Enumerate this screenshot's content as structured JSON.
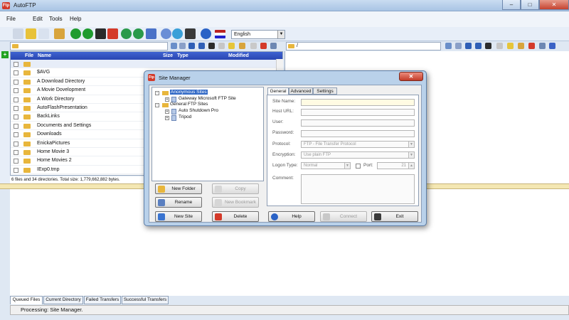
{
  "window": {
    "title": "AutoFTP",
    "app_badge": "Ftp",
    "min": "–",
    "max": "□",
    "close": "✕"
  },
  "menu": {
    "items": [
      "File",
      "Edit",
      "Tools",
      "Help"
    ]
  },
  "toolbar": {
    "language": "English"
  },
  "left_pane": {
    "path": "",
    "columns": [
      "File",
      "Name",
      "Size",
      "Type",
      "Modified"
    ],
    "rows": [
      "",
      "$AVG",
      "A Download Directory",
      "A Movie Dovelopment",
      "A Work Directory",
      "AutoFlashPresentation",
      "BackLinks",
      "Documents and Settings",
      "Downloads",
      "EnickaPictures",
      "Home Movie 3",
      "Home Movies 2",
      "IExp0.tmp"
    ],
    "status": "6 files and 34 directories. Total size: 1,779,662,882 bytes."
  },
  "right_pane": {
    "path": "/"
  },
  "queue_tabs": [
    "Queued Files",
    "Current Directory",
    "Failed Transfers",
    "Successful Transfers"
  ],
  "status_bar": {
    "text": "Processing: Site Manager."
  },
  "site_manager": {
    "title": "Site Manager",
    "close": "✕",
    "tree": {
      "anonymous": "Anonymous Sites",
      "anonymous_child": "Gateway Microsoft FTP Site",
      "general": "General FTP Sites",
      "general_children": [
        "Auto Shutdown Pro",
        "Tripod"
      ]
    },
    "buttons": {
      "new_folder": "New Folder",
      "copy": "Copy",
      "rename": "Rename",
      "new_bookmark": "New Bookmark",
      "new_site": "New Site",
      "delete": "Delete",
      "help": "Help",
      "connect": "Connect",
      "exit": "Exit"
    },
    "tabs": [
      "General",
      "Advanced",
      "Settings"
    ],
    "fields": {
      "site_name": "Site Name:",
      "host_url": "Host URL:",
      "user": "User:",
      "password": "Password:",
      "protocol": "Protocol:",
      "protocol_value": "FTP - File Transfer Protocol",
      "encryption": "Encryption:",
      "encryption_value": "Use plain FTP",
      "logon_type": "Logon Type:",
      "logon_value": "Normal",
      "port_label": "Port:",
      "port_value": "21",
      "comment": "Comment:"
    }
  }
}
